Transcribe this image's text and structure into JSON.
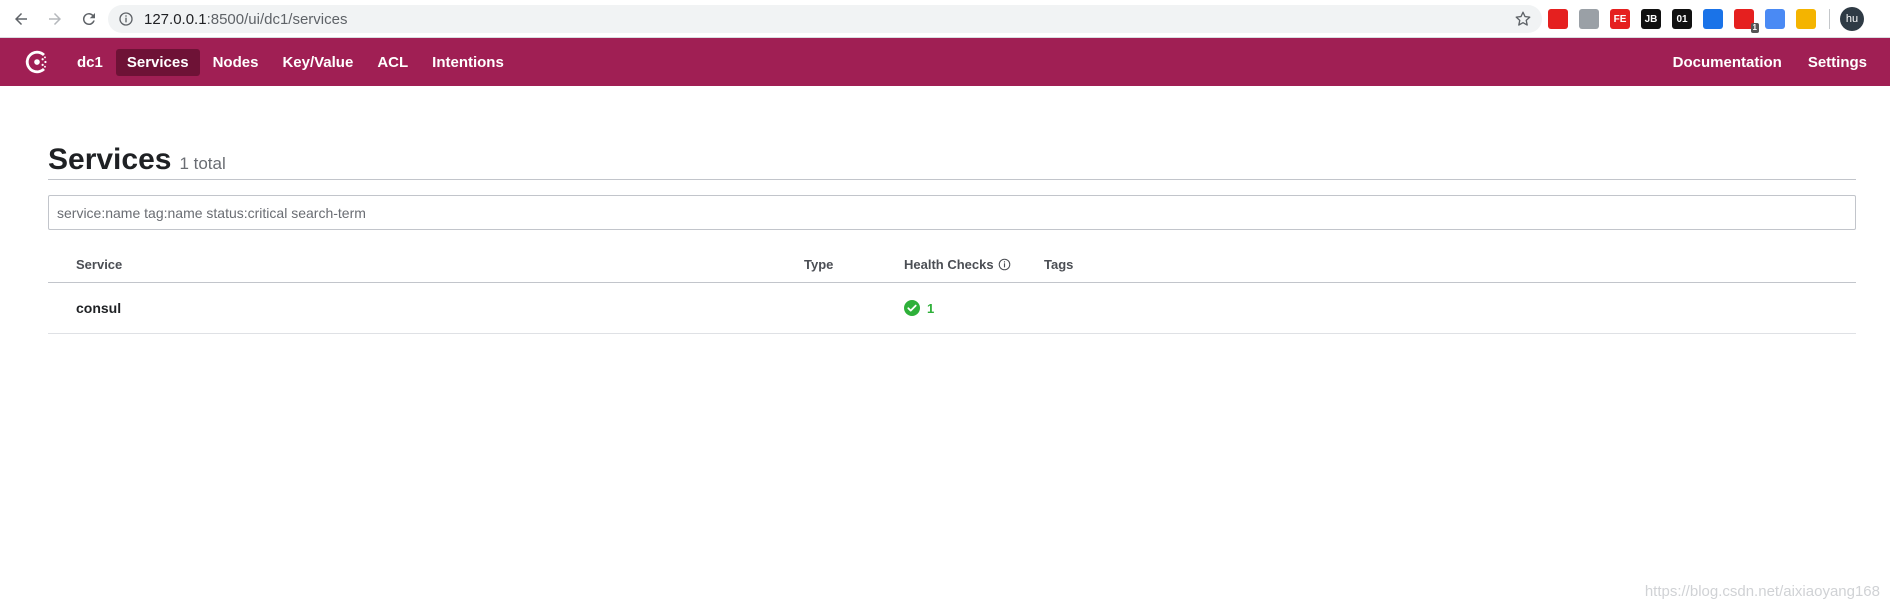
{
  "browser": {
    "url_host": "127.0.0.1",
    "url_path": ":8500/ui/dc1/services",
    "avatar_text": "hu",
    "extensions": [
      {
        "icon": "adblock-icon",
        "color": "#e5201f",
        "label": ""
      },
      {
        "icon": "tree-icon",
        "color": "#9aa0a6",
        "label": ""
      },
      {
        "icon": "fe-icon",
        "color": "#e5201f",
        "label": "FE"
      },
      {
        "icon": "jb-icon",
        "color": "#111111",
        "label": "JB"
      },
      {
        "icon": "01-icon",
        "color": "#111111",
        "label": "01"
      },
      {
        "icon": "vue-icon",
        "color": "#1a73e8",
        "label": ""
      },
      {
        "icon": "dots-icon",
        "color": "#e5201f",
        "label": "",
        "badge": "1"
      },
      {
        "icon": "translate-icon",
        "color": "#4a8af4",
        "label": ""
      },
      {
        "icon": "house-icon",
        "color": "#f4b400",
        "label": ""
      }
    ]
  },
  "nav": {
    "datacenter": "dc1",
    "items": [
      {
        "label": "Services",
        "active": true
      },
      {
        "label": "Nodes",
        "active": false
      },
      {
        "label": "Key/Value",
        "active": false
      },
      {
        "label": "ACL",
        "active": false
      },
      {
        "label": "Intentions",
        "active": false
      }
    ],
    "right": [
      {
        "label": "Documentation"
      },
      {
        "label": "Settings"
      }
    ],
    "brand_color": "#a01f54",
    "active_color": "#6e1236"
  },
  "page": {
    "title": "Services",
    "total": "1 total",
    "search_placeholder": "service:name tag:name status:critical search-term"
  },
  "table": {
    "headers": {
      "service": "Service",
      "type": "Type",
      "health": "Health Checks",
      "tags": "Tags"
    },
    "rows": [
      {
        "service": "consul",
        "type": "",
        "health_passing": "1",
        "tags": ""
      }
    ],
    "passing_color": "#2eb039"
  },
  "watermark": "https://blog.csdn.net/aixiaoyang168"
}
